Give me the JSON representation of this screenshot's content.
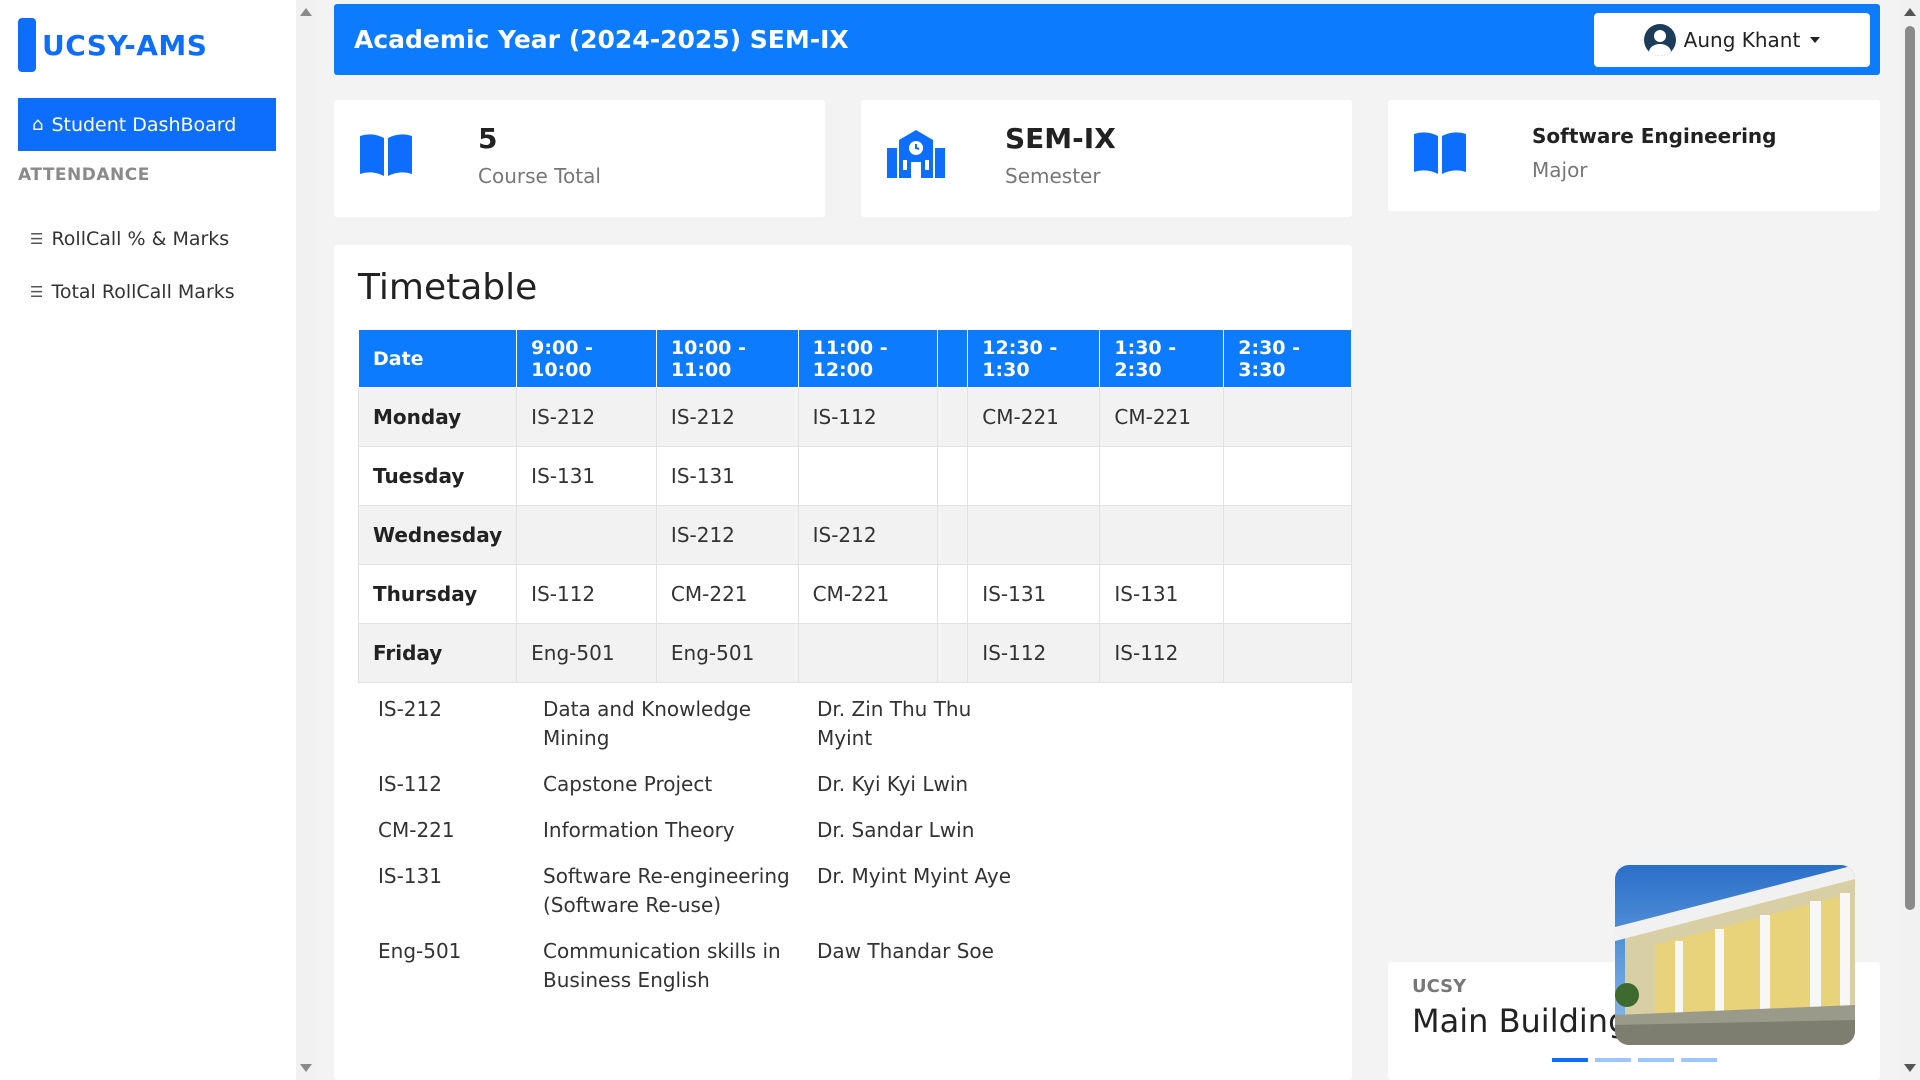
{
  "sidebar": {
    "brand": "UCSY-AMS",
    "active_item": "Student DashBoard",
    "section_label": "ATTENDANCE",
    "items": [
      "RollCall % & Marks",
      "Total RollCall Marks"
    ]
  },
  "header": {
    "title": "Academic Year (2024-2025) SEM-IX",
    "user_name": "Aung Khant"
  },
  "stats": [
    {
      "value": "5",
      "label": "Course Total",
      "icon": "book-icon"
    },
    {
      "value": "SEM-IX",
      "label": "Semester",
      "icon": "school-icon"
    },
    {
      "value": "Software Engineering",
      "label": "Major",
      "icon": "book-icon"
    }
  ],
  "timetable": {
    "title": "Timetable",
    "headers": [
      "Date",
      "9:00 - 10:00",
      "10:00 - 11:00",
      "11:00 - 12:00",
      "",
      "12:30 - 1:30",
      "1:30 - 2:30",
      "2:30 - 3:30"
    ],
    "rows": [
      [
        "Monday",
        "IS-212",
        "IS-212",
        "IS-112",
        "",
        "CM-221",
        "CM-221",
        ""
      ],
      [
        "Tuesday",
        "IS-131",
        "IS-131",
        "",
        "",
        "",
        "",
        ""
      ],
      [
        "Wednesday",
        "",
        "IS-212",
        "IS-212",
        "",
        "",
        "",
        ""
      ],
      [
        "Thursday",
        "IS-112",
        "CM-221",
        "CM-221",
        "",
        "IS-131",
        "IS-131",
        ""
      ],
      [
        "Friday",
        "Eng-501",
        "Eng-501",
        "",
        "",
        "IS-112",
        "IS-112",
        ""
      ]
    ]
  },
  "courses": [
    {
      "code": "IS-212",
      "name": "Data and Knowledge Mining",
      "teacher": "Dr. Zin Thu Thu Myint"
    },
    {
      "code": "IS-112",
      "name": "Capstone Project",
      "teacher": "Dr. Kyi Kyi Lwin"
    },
    {
      "code": "CM-221",
      "name": "Information Theory",
      "teacher": "Dr. Sandar Lwin"
    },
    {
      "code": "IS-131",
      "name": "Software Re-engineering (Software Re-use)",
      "teacher": "Dr. Myint Myint Aye"
    },
    {
      "code": "Eng-501",
      "name": "Communication skills in Business English",
      "teacher": "Daw Thandar Soe"
    }
  ],
  "carousel": {
    "small_label": "UCSY",
    "caption": "Main Building",
    "slides": 4,
    "active": 0
  },
  "colors": {
    "primary": "#0d6efd",
    "header": "#0d7bfd"
  }
}
